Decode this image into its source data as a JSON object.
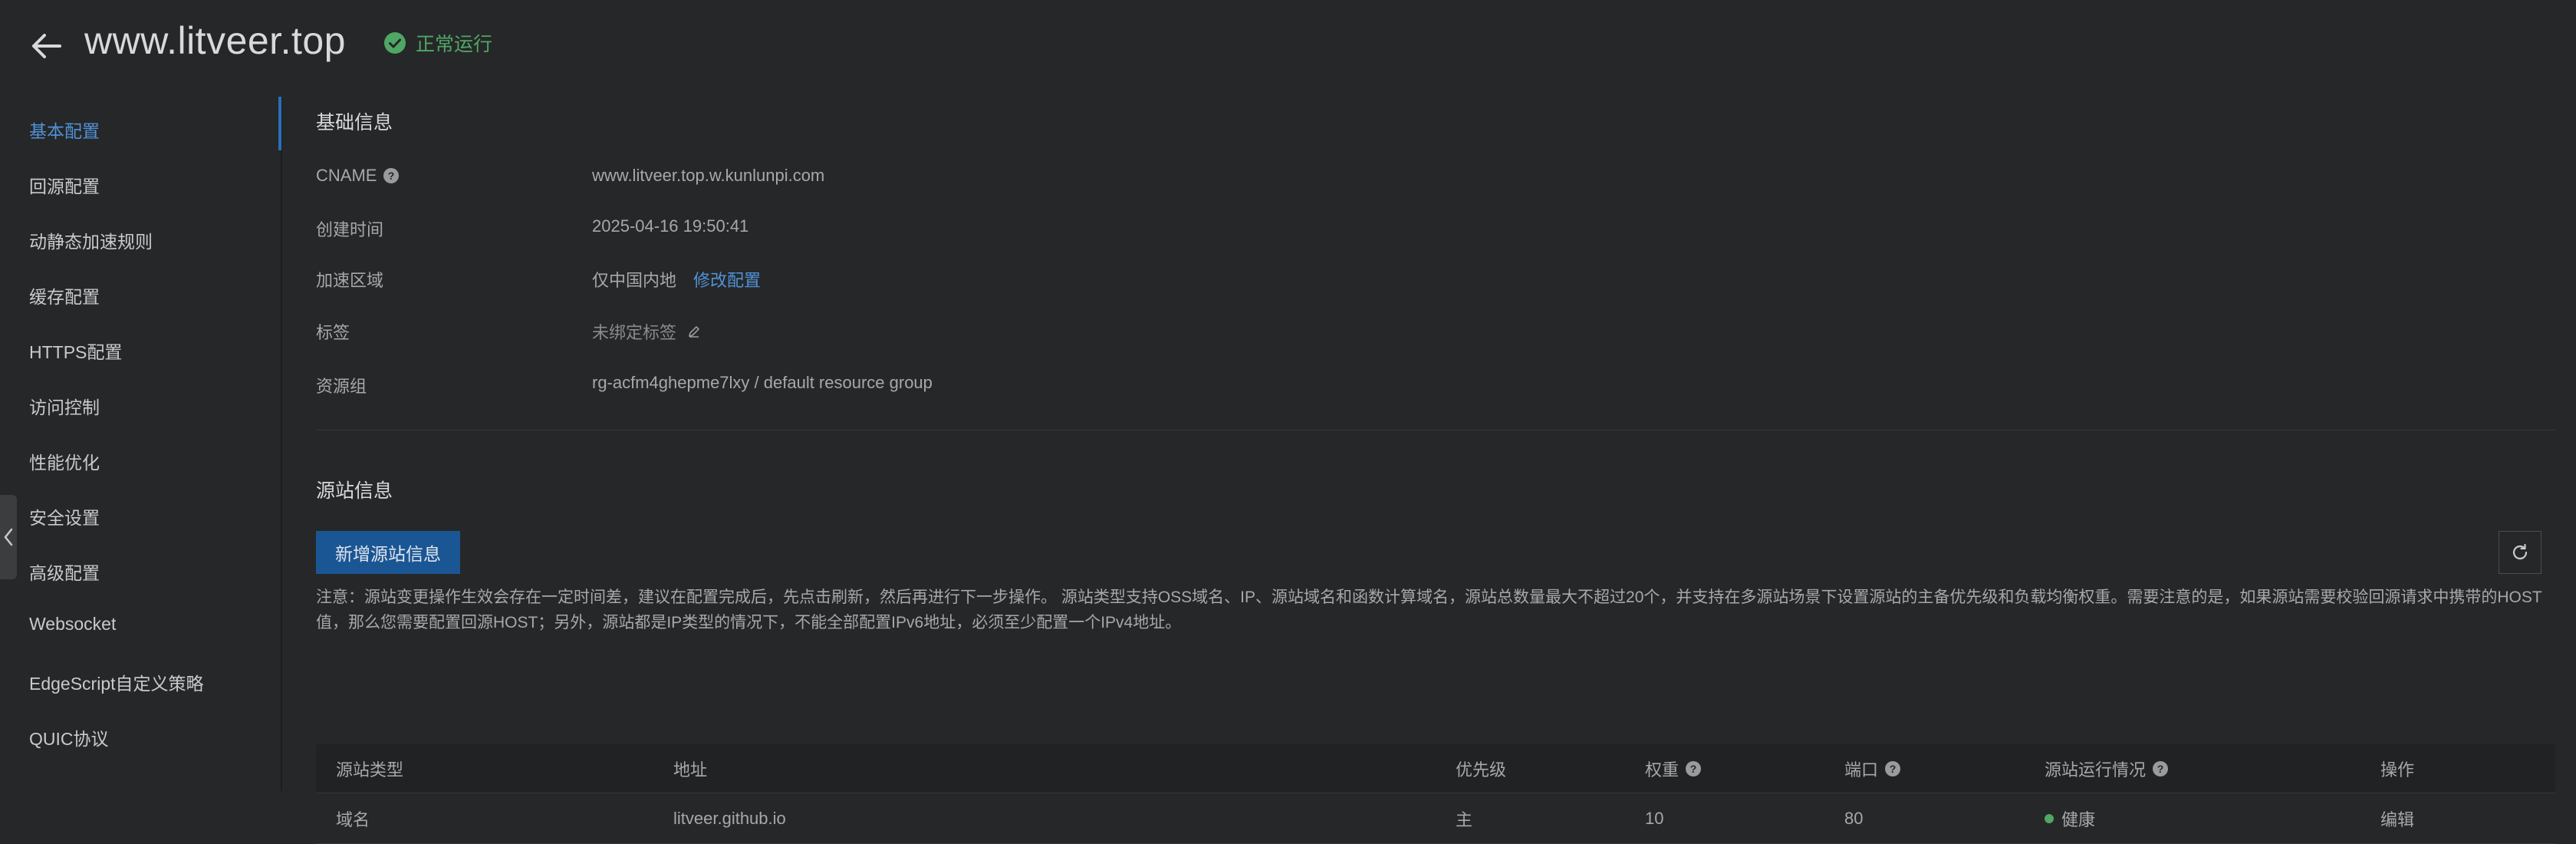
{
  "header": {
    "title": "www.litveer.top",
    "status": "正常运行"
  },
  "sidebar": {
    "items": [
      {
        "label": "基本配置"
      },
      {
        "label": "回源配置"
      },
      {
        "label": "动静态加速规则"
      },
      {
        "label": "缓存配置"
      },
      {
        "label": "HTTPS配置"
      },
      {
        "label": "访问控制"
      },
      {
        "label": "性能优化"
      },
      {
        "label": "安全设置"
      },
      {
        "label": "高级配置"
      },
      {
        "label": "Websocket"
      },
      {
        "label": "EdgeScript自定义策略"
      },
      {
        "label": "QUIC协议"
      }
    ]
  },
  "basic_info": {
    "title": "基础信息",
    "cname_label": "CNAME",
    "cname_value": "www.litveer.top.w.kunlunpi.com",
    "created_label": "创建时间",
    "created_value": "2025-04-16 19:50:41",
    "region_label": "加速区域",
    "region_value": "仅中国内地",
    "region_edit": "修改配置",
    "tags_label": "标签",
    "tags_value": "未绑定标签",
    "resource_group_label": "资源组",
    "resource_group_value": "rg-acfm4ghepme7lxy / default resource group"
  },
  "origin_info": {
    "title": "源站信息",
    "add_button": "新增源站信息",
    "notice": "注意：源站变更操作生效会存在一定时间差，建议在配置完成后，先点击刷新，然后再进行下一步操作。 源站类型支持OSS域名、IP、源站域名和函数计算域名，源站总数量最大不超过20个，并支持在多源站场景下设置源站的主备优先级和负载均衡权重。需要注意的是，如果源站需要校验回源请求中携带的HOST值，那么您需要配置回源HOST；另外，源站都是IP类型的情况下，不能全部配置IPv6地址，必须至少配置一个IPv4地址。",
    "columns": [
      "源站类型",
      "地址",
      "优先级",
      "权重",
      "端口",
      "源站运行情况",
      "操作"
    ],
    "rows": [
      {
        "type": "域名",
        "address": "litveer.github.io",
        "priority": "主",
        "weight": "10",
        "port": "80",
        "health": "健康",
        "action": "编辑"
      }
    ]
  },
  "colors": {
    "accent": "#4f92d7",
    "primary_button": "#1b5694",
    "success": "#4ea765",
    "background": "#262728"
  }
}
